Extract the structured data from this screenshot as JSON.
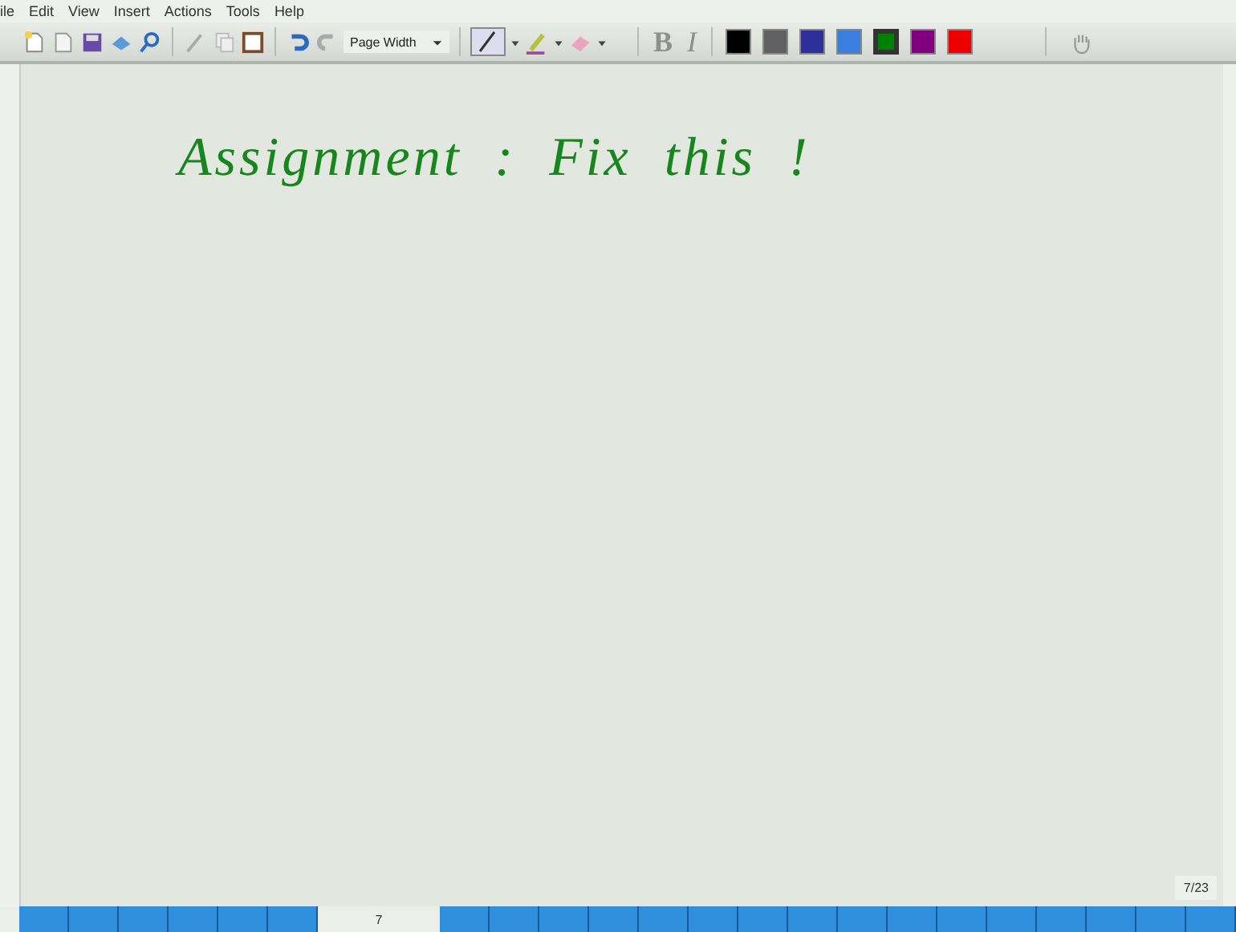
{
  "menu": [
    "ile",
    "Edit",
    "View",
    "Insert",
    "Actions",
    "Tools",
    "Help"
  ],
  "toolbar": {
    "zoom": "Page Width",
    "bold": {
      "label": "B",
      "disabled": true
    },
    "italic": {
      "label": "I",
      "disabled": true
    },
    "colors": [
      {
        "color": "#000000",
        "selected": false
      },
      {
        "color": "#606060",
        "selected": false
      },
      {
        "color": "#2f2f9a",
        "selected": false
      },
      {
        "color": "#3a7ee0",
        "selected": false
      },
      {
        "color": "#008000",
        "selected": true
      },
      {
        "color": "#800080",
        "selected": false
      },
      {
        "color": "#ee0000",
        "selected": false
      }
    ]
  },
  "page": {
    "ink": "Assignment : Fix this !",
    "page_indicator": "7/23"
  },
  "page_strip": {
    "current": "7"
  }
}
